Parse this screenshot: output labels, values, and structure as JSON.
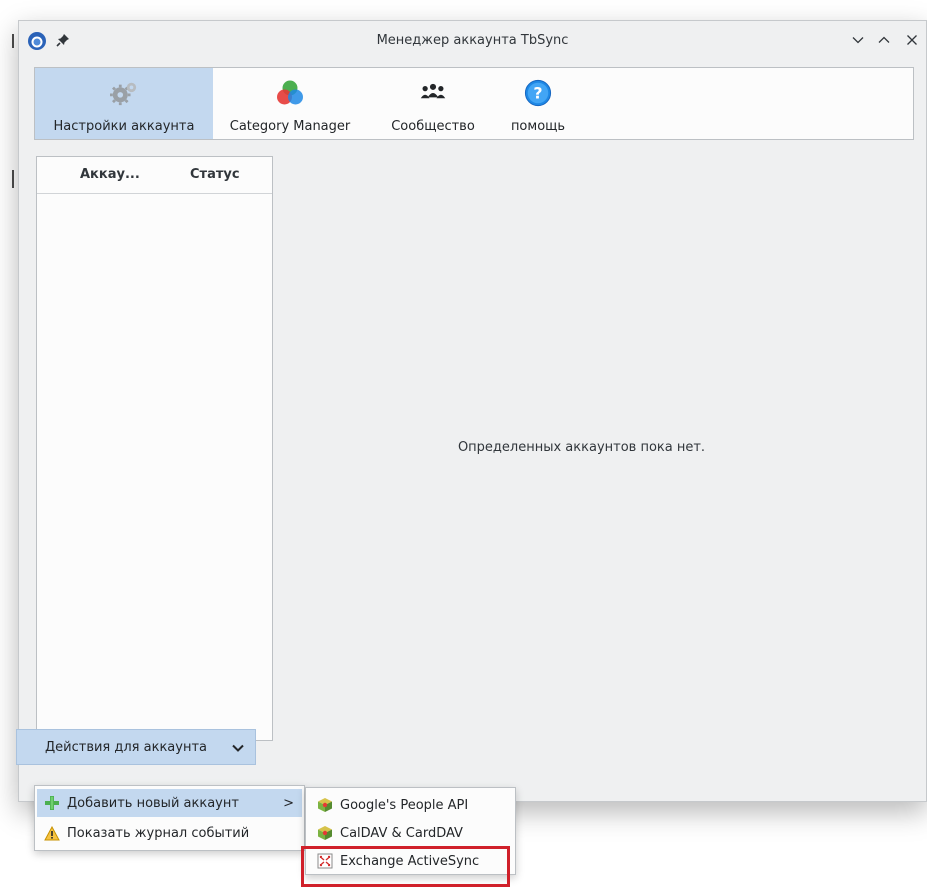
{
  "window": {
    "title": "Менеджер аккаунта TbSync"
  },
  "toolbar": {
    "items": [
      {
        "label": "Настройки аккаунта",
        "icon": "gears-icon"
      },
      {
        "label": "Category Manager",
        "icon": "color-circles-icon"
      },
      {
        "label": "Сообщество",
        "icon": "people-icon"
      },
      {
        "label": "помощь",
        "icon": "help-icon"
      }
    ]
  },
  "account_list": {
    "columns": [
      "Аккау...",
      "Статус"
    ],
    "rows": []
  },
  "main": {
    "empty_message": "Определенных аккаунтов пока нет."
  },
  "actions": {
    "button_label": "Действия для аккаунта"
  },
  "menu": {
    "items": [
      {
        "label": "Добавить новый аккаунт",
        "icon": "plus-icon",
        "has_submenu": true,
        "submenu_arrow": ">"
      },
      {
        "label": "Показать журнал событий",
        "icon": "warning-icon"
      }
    ]
  },
  "submenu": {
    "items": [
      {
        "label": "Google's People API",
        "icon": "provider-cube-icon"
      },
      {
        "label": "CalDAV & CardDAV",
        "icon": "provider-cube-icon"
      },
      {
        "label": "Exchange ActiveSync",
        "icon": "exchange-icon"
      }
    ]
  },
  "colors": {
    "selection": "#c3d8ef",
    "highlight_box": "#d0202a"
  }
}
